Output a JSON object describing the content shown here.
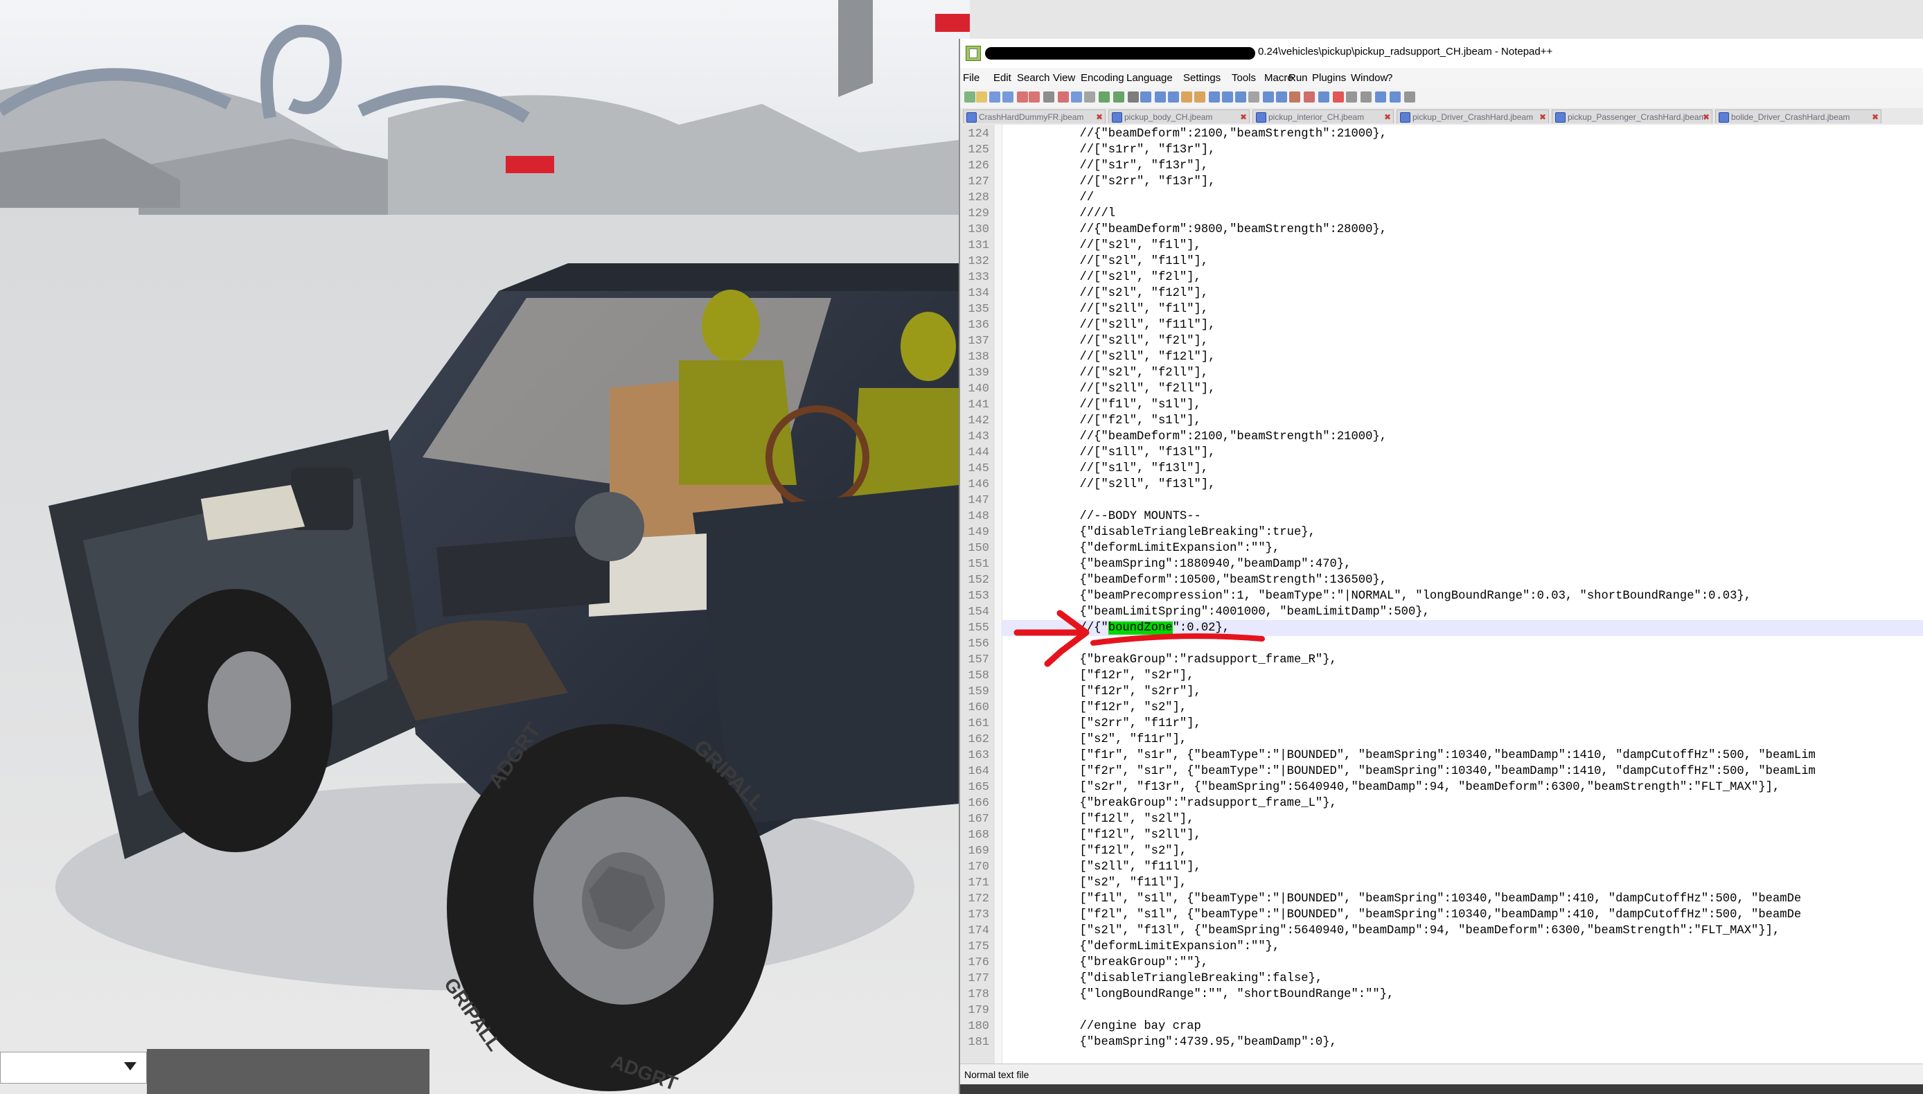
{
  "window": {
    "title": "0.24\\vehicles\\pickup\\pickup_radsupport_CH.jbeam - Notepad++"
  },
  "menu": [
    "File",
    "Edit",
    "Search",
    "View",
    "Encoding",
    "Language",
    "Settings",
    "Tools",
    "Macro",
    "Run",
    "Plugins",
    "Window",
    "?"
  ],
  "tabs": [
    "CrashHardDummyFR.jbeam",
    "pickup_body_CH.jbeam",
    "pickup_interior_CH.jbeam",
    "pickup_Driver_CrashHard.jbeam",
    "pickup_Passenger_CrashHard.jbeam",
    "bolide_Driver_CrashHard.jbeam"
  ],
  "editor": {
    "highlighted_line": 155,
    "highlighted_token": "boundZone",
    "lines": [
      {
        "n": "124",
        "t": "        //{\"beamDeform\":2100,\"beamStrength\":21000},"
      },
      {
        "n": "125",
        "t": "        //[\"s1rr\", \"f13r\"],"
      },
      {
        "n": "126",
        "t": "        //[\"s1r\", \"f13r\"],"
      },
      {
        "n": "127",
        "t": "        //[\"s2rr\", \"f13r\"],"
      },
      {
        "n": "128",
        "t": "        //"
      },
      {
        "n": "129",
        "t": "        ////l"
      },
      {
        "n": "130",
        "t": "        //{\"beamDeform\":9800,\"beamStrength\":28000},"
      },
      {
        "n": "131",
        "t": "        //[\"s2l\", \"f1l\"],"
      },
      {
        "n": "132",
        "t": "        //[\"s2l\", \"f11l\"],"
      },
      {
        "n": "133",
        "t": "        //[\"s2l\", \"f2l\"],"
      },
      {
        "n": "134",
        "t": "        //[\"s2l\", \"f12l\"],"
      },
      {
        "n": "135",
        "t": "        //[\"s2ll\", \"f1l\"],"
      },
      {
        "n": "136",
        "t": "        //[\"s2ll\", \"f11l\"],"
      },
      {
        "n": "137",
        "t": "        //[\"s2ll\", \"f2l\"],"
      },
      {
        "n": "138",
        "t": "        //[\"s2ll\", \"f12l\"],"
      },
      {
        "n": "139",
        "t": "        //[\"s2l\", \"f2ll\"],"
      },
      {
        "n": "140",
        "t": "        //[\"s2ll\", \"f2ll\"],"
      },
      {
        "n": "141",
        "t": "        //[\"f1l\", \"s1l\"],"
      },
      {
        "n": "142",
        "t": "        //[\"f2l\", \"s1l\"],"
      },
      {
        "n": "143",
        "t": "        //{\"beamDeform\":2100,\"beamStrength\":21000},"
      },
      {
        "n": "144",
        "t": "        //[\"s1ll\", \"f13l\"],"
      },
      {
        "n": "145",
        "t": "        //[\"s1l\", \"f13l\"],"
      },
      {
        "n": "146",
        "t": "        //[\"s2ll\", \"f13l\"],"
      },
      {
        "n": "147",
        "t": ""
      },
      {
        "n": "148",
        "t": "        //--BODY MOUNTS--"
      },
      {
        "n": "149",
        "t": "        {\"disableTriangleBreaking\":true},"
      },
      {
        "n": "150",
        "t": "        {\"deformLimitExpansion\":\"\"},"
      },
      {
        "n": "151",
        "t": "        {\"beamSpring\":1880940,\"beamDamp\":470},"
      },
      {
        "n": "152",
        "t": "        {\"beamDeform\":10500,\"beamStrength\":136500},"
      },
      {
        "n": "153",
        "t": "        {\"beamPrecompression\":1, \"beamType\":\"|NORMAL\", \"longBoundRange\":0.03, \"shortBoundRange\":0.03},"
      },
      {
        "n": "154",
        "t": "        {\"beamLimitSpring\":4001000, \"beamLimitDamp\":500},"
      },
      {
        "n": "155",
        "t": "        //{\"boundZone\":0.02},"
      },
      {
        "n": "156",
        "t": ""
      },
      {
        "n": "157",
        "t": "        {\"breakGroup\":\"radsupport_frame_R\"},"
      },
      {
        "n": "158",
        "t": "        [\"f12r\", \"s2r\"],"
      },
      {
        "n": "159",
        "t": "        [\"f12r\", \"s2rr\"],"
      },
      {
        "n": "160",
        "t": "        [\"f12r\", \"s2\"],"
      },
      {
        "n": "161",
        "t": "        [\"s2rr\", \"f11r\"],"
      },
      {
        "n": "162",
        "t": "        [\"s2\", \"f11r\"],"
      },
      {
        "n": "163",
        "t": "        [\"f1r\", \"s1r\", {\"beamType\":\"|BOUNDED\", \"beamSpring\":10340,\"beamDamp\":1410, \"dampCutoffHz\":500, \"beamLim"
      },
      {
        "n": "164",
        "t": "        [\"f2r\", \"s1r\", {\"beamType\":\"|BOUNDED\", \"beamSpring\":10340,\"beamDamp\":1410, \"dampCutoffHz\":500, \"beamLim"
      },
      {
        "n": "165",
        "t": "        [\"s2r\", \"f13r\", {\"beamSpring\":5640940,\"beamDamp\":94, \"beamDeform\":6300,\"beamStrength\":\"FLT_MAX\"}],"
      },
      {
        "n": "166",
        "t": "        {\"breakGroup\":\"radsupport_frame_L\"},"
      },
      {
        "n": "167",
        "t": "        [\"f12l\", \"s2l\"],"
      },
      {
        "n": "168",
        "t": "        [\"f12l\", \"s2ll\"],"
      },
      {
        "n": "169",
        "t": "        [\"f12l\", \"s2\"],"
      },
      {
        "n": "170",
        "t": "        [\"s2ll\", \"f11l\"],"
      },
      {
        "n": "171",
        "t": "        [\"s2\", \"f11l\"],"
      },
      {
        "n": "172",
        "t": "        [\"f1l\", \"s1l\", {\"beamType\":\"|BOUNDED\", \"beamSpring\":10340,\"beamDamp\":410, \"dampCutoffHz\":500, \"beamDe"
      },
      {
        "n": "173",
        "t": "        [\"f2l\", \"s1l\", {\"beamType\":\"|BOUNDED\", \"beamSpring\":10340,\"beamDamp\":410, \"dampCutoffHz\":500, \"beamDe"
      },
      {
        "n": "174",
        "t": "        [\"s2l\", \"f13l\", {\"beamSpring\":5640940,\"beamDamp\":94, \"beamDeform\":6300,\"beamStrength\":\"FLT_MAX\"}],"
      },
      {
        "n": "175",
        "t": "        {\"deformLimitExpansion\":\"\"},"
      },
      {
        "n": "176",
        "t": "        {\"breakGroup\":\"\"},"
      },
      {
        "n": "177",
        "t": "        {\"disableTriangleBreaking\":false},"
      },
      {
        "n": "178",
        "t": "        {\"longBoundRange\":\"\", \"shortBoundRange\":\"\"},"
      },
      {
        "n": "179",
        "t": ""
      },
      {
        "n": "180",
        "t": "        //engine bay crap"
      },
      {
        "n": "181",
        "t": "        {\"beamSpring\":4739.95,\"beamDamp\":0},"
      }
    ]
  },
  "status": {
    "file_type": "Normal text file"
  },
  "scene": {
    "tire_brand_1": "ADGRT",
    "tire_brand_2": "GRIPALL",
    "tire_text_1": "ADGRT",
    "tire_text_2": "GRIPALL"
  }
}
